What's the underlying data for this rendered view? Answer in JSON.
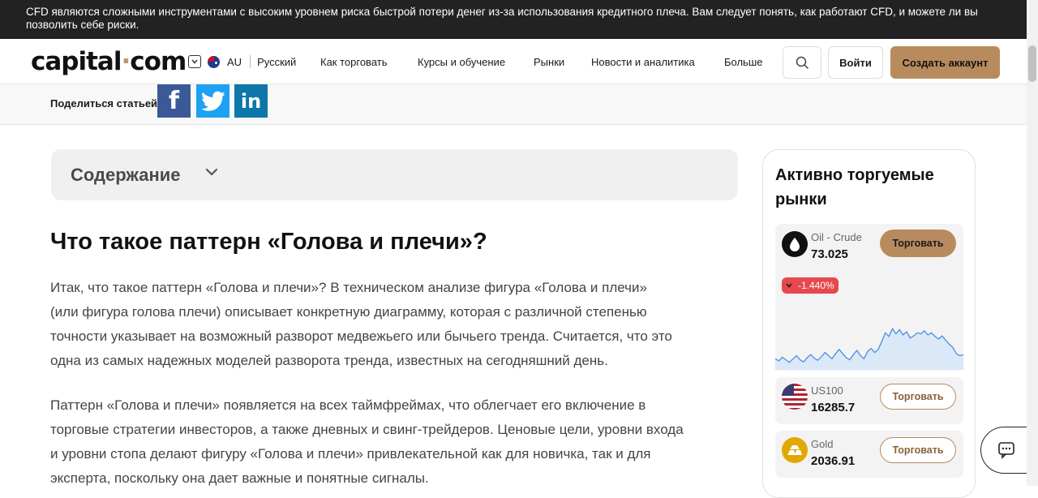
{
  "risk_warning": "CFD являются сложными инструментами с высоким уровнем риска быстрой потери денег из-за использования кредитного плеча. Вам следует понять, как работают CFD, и можете ли вы позволить себе риски.",
  "header": {
    "logo_main": "capital",
    "logo_dot": "·",
    "logo_tld": "com",
    "region": "AU",
    "language": "Русский",
    "nav": [
      "Как торговать",
      "Курсы и обучение",
      "Рынки",
      "Новости и аналитика",
      "Больше"
    ],
    "login": "Войти",
    "signup": "Создать аккаунт"
  },
  "share": {
    "label": "Поделиться статьей",
    "facebook": "f",
    "linkedin": "in"
  },
  "toc": {
    "title": "Содержание"
  },
  "article": {
    "title": "Что такое паттерн «Голова и плечи»?",
    "paragraphs": [
      [
        "Итак, что такое паттерн «Голова и плечи»? В техническом анализе фигура «Голова и плечи»",
        "(или фигура голова плечи) описывает конкретную диаграмму, которая с различной степенью",
        "точности указывает на возможный разворот медвежьего или бычьего тренда. Считается, что это",
        "одна из самых надежных моделей разворота тренда, известных на сегодняшний день."
      ],
      [
        "Паттерн «Голова и плечи» появляется на всех таймфреймах, что облегчает его включение в",
        "торговые стратегии инвесторов, а также дневных и свинг-трейдеров. Ценовые цели, уровни входа",
        "и уровни стопа делают фигуру «Голова и плечи» привлекательной как для новичка, так и для",
        "эксперта, поскольку она дает важные и понятные сигналы."
      ]
    ]
  },
  "sidebar": {
    "title": "Активно торгуемые рынки",
    "markets": [
      {
        "name": "Oil - Crude",
        "price": "73.025",
        "change": "-1.440%",
        "trade": "Торговать"
      },
      {
        "name": "US100",
        "price": "16285.7",
        "trade": "Торговать"
      },
      {
        "name": "Gold",
        "price": "2036.91",
        "trade": "Торговать"
      }
    ],
    "sparkline": [
      0.12,
      0.08,
      0.15,
      0.1,
      0.05,
      0.12,
      0.18,
      0.1,
      0.06,
      0.14,
      0.2,
      0.13,
      0.09,
      0.16,
      0.24,
      0.18,
      0.12,
      0.22,
      0.3,
      0.22,
      0.14,
      0.1,
      0.2,
      0.28,
      0.18,
      0.12,
      0.26,
      0.32,
      0.24,
      0.3,
      0.45,
      0.62,
      0.55,
      0.7,
      0.6,
      0.68,
      0.58,
      0.64,
      0.52,
      0.56,
      0.62,
      0.6,
      0.66,
      0.58,
      0.62,
      0.55,
      0.5,
      0.56,
      0.48,
      0.4,
      0.34,
      0.22,
      0.18,
      0.2
    ],
    "colors": {
      "chart_line": "#4a90e2",
      "chart_fill": "#dbe8f7",
      "accent": "#b88b5e",
      "negative": "#e5484d"
    }
  }
}
